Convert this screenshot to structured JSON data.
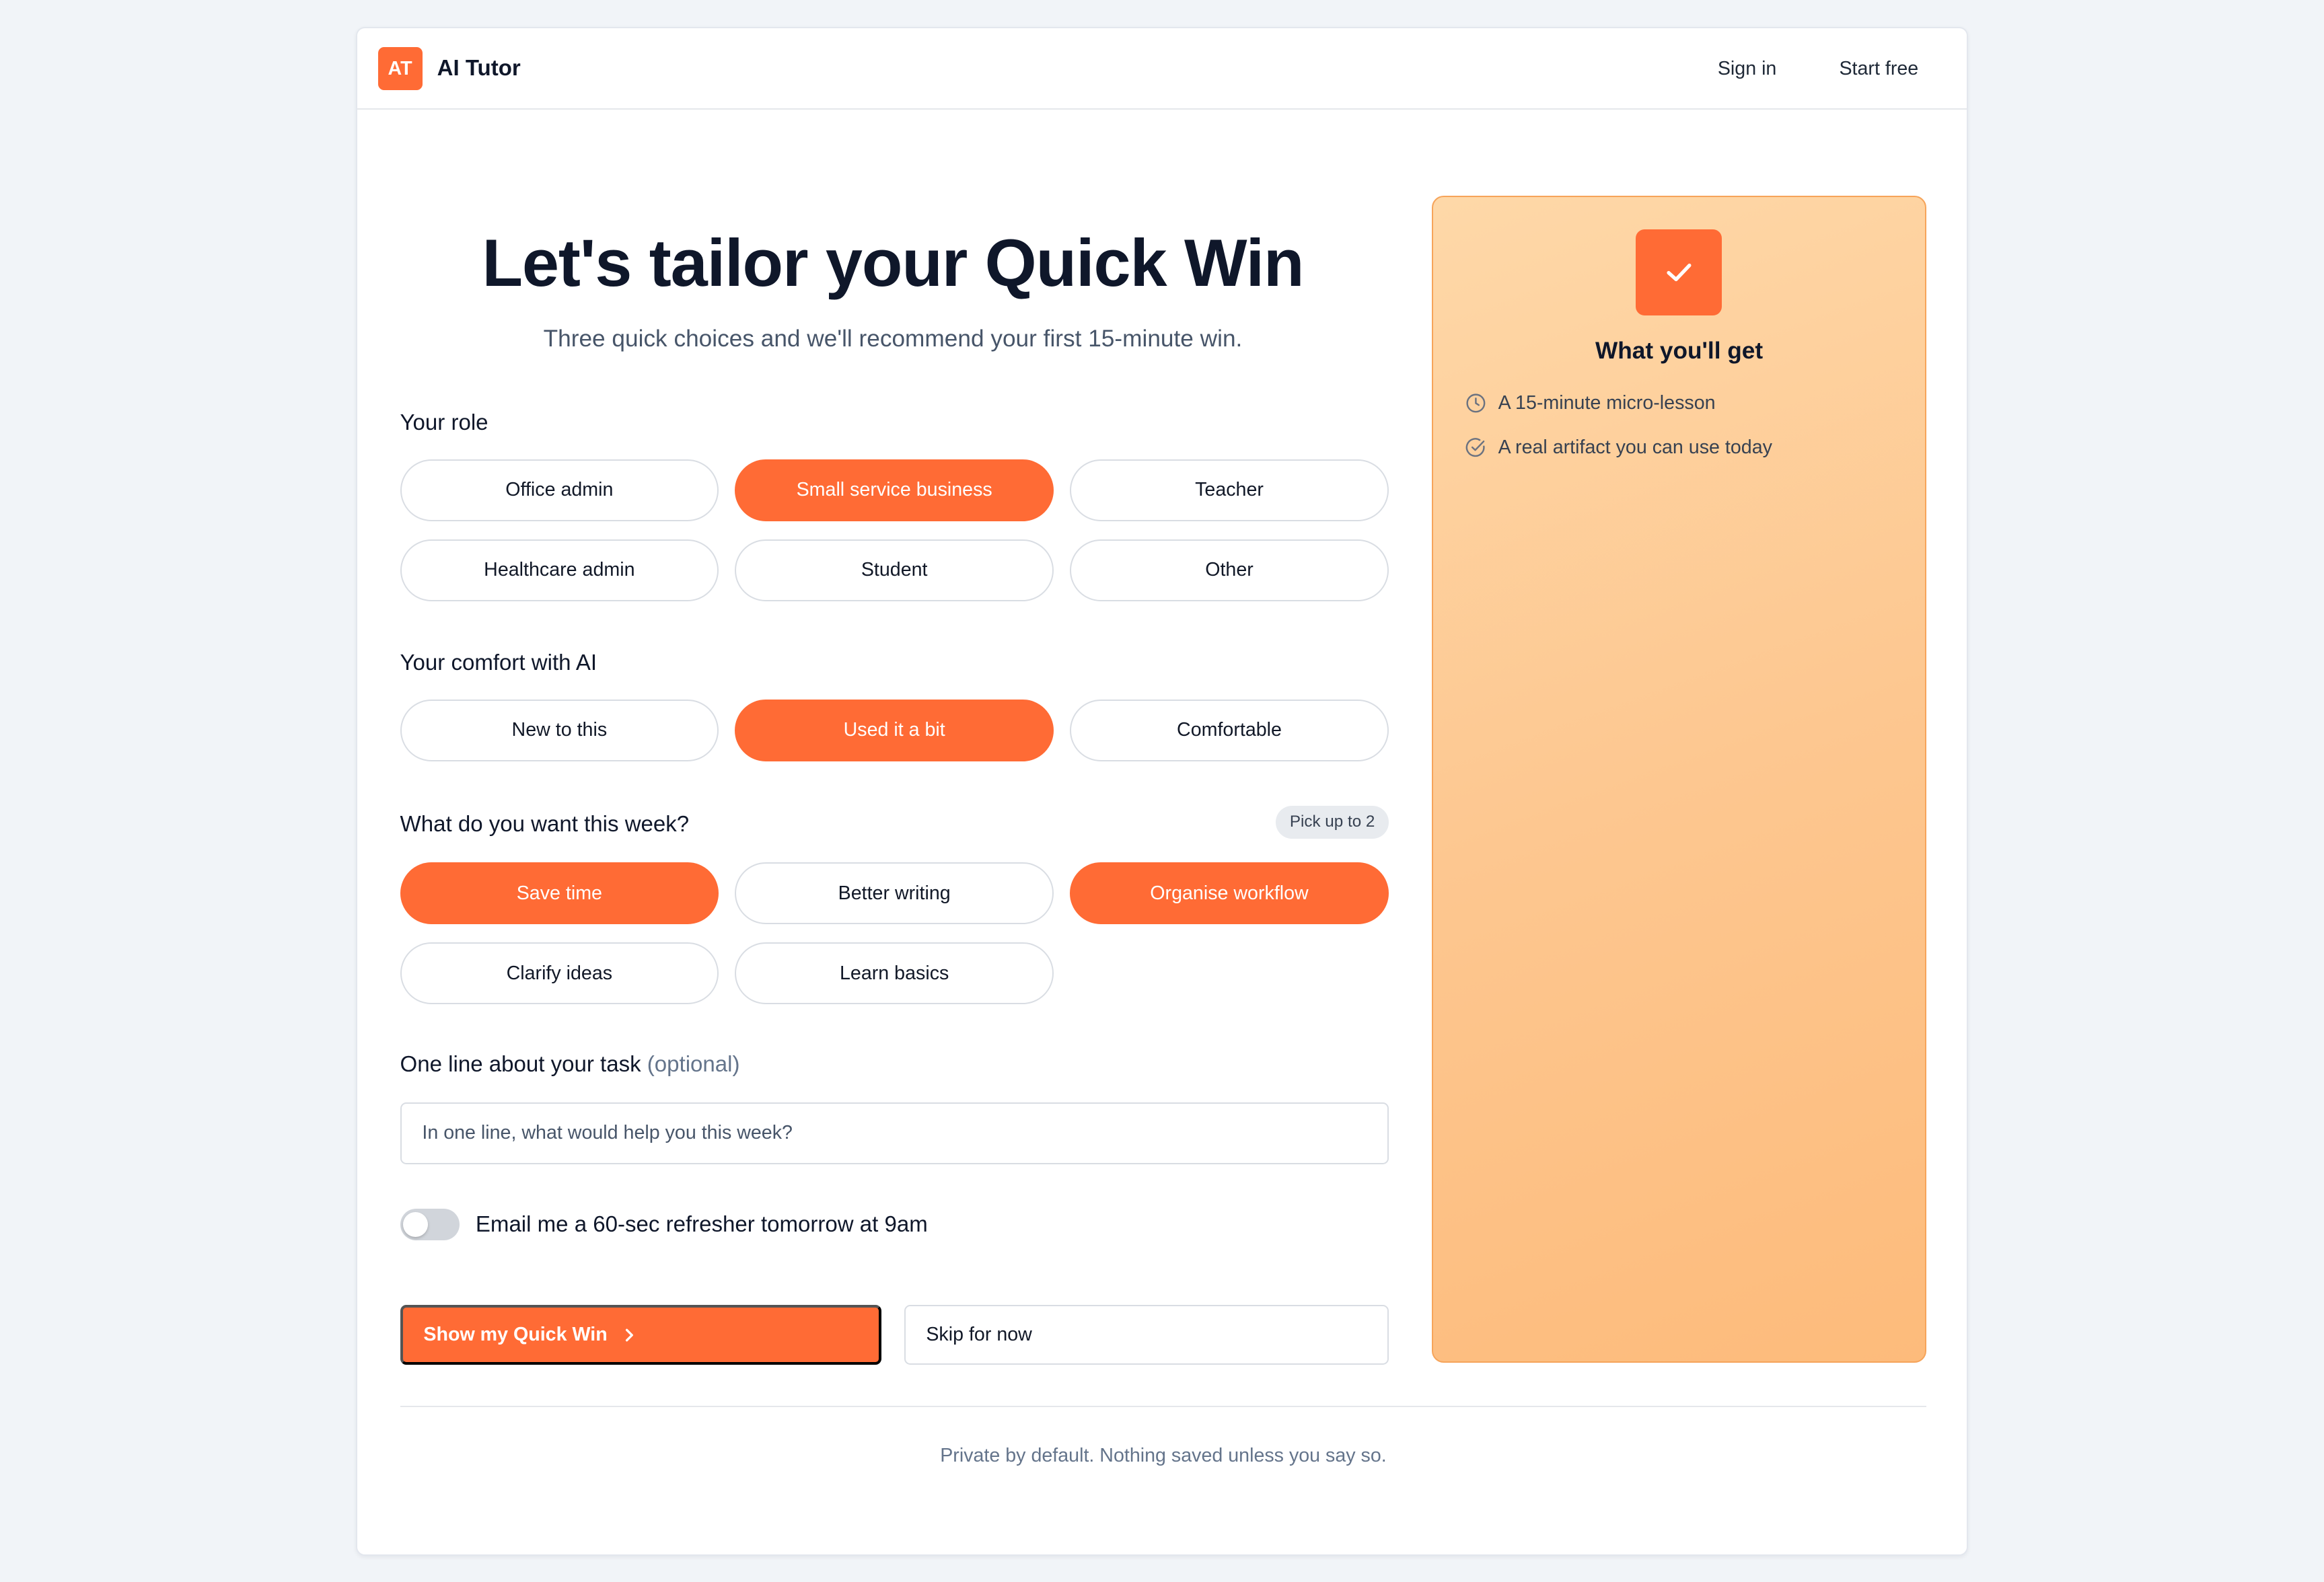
{
  "brand": {
    "logo_text": "AT",
    "name": "AI Tutor"
  },
  "nav": {
    "sign_in": "Sign in",
    "start_free": "Start free"
  },
  "hero": {
    "title": "Let's tailor your Quick Win",
    "subtitle": "Three quick choices and we'll recommend your first 15-minute win."
  },
  "role": {
    "label": "Your role",
    "options": [
      "Office admin",
      "Small service business",
      "Teacher",
      "Healthcare admin",
      "Student",
      "Other"
    ],
    "selected": [
      "Small service business"
    ]
  },
  "comfort": {
    "label": "Your comfort with AI",
    "options": [
      "New to this",
      "Used it a bit",
      "Comfortable"
    ],
    "selected": [
      "Used it a bit"
    ]
  },
  "goals": {
    "label": "What do you want this week?",
    "badge": "Pick up to 2",
    "options": [
      "Save time",
      "Better writing",
      "Organise workflow",
      "Clarify ideas",
      "Learn basics"
    ],
    "selected": [
      "Save time",
      "Organise workflow"
    ]
  },
  "task": {
    "label": "One line about your task",
    "optional": "(optional)",
    "placeholder": "In one line, what would help you this week?",
    "value": ""
  },
  "reminder": {
    "label": "Email me a 60-sec refresher tomorrow at 9am",
    "enabled": false
  },
  "actions": {
    "primary": "Show my Quick Win",
    "secondary": "Skip for now"
  },
  "footer": {
    "note": "Private by default. Nothing saved unless you say so."
  },
  "side_panel": {
    "title": "What you'll get",
    "benefits": [
      {
        "icon": "clock-icon",
        "text": "A 15-minute micro-lesson"
      },
      {
        "icon": "check-circle-icon",
        "text": "A real artifact you can use today"
      }
    ]
  },
  "colors": {
    "accent": "#ff6b35",
    "panel_gradient_start": "#fed8a8",
    "panel_gradient_end": "#fdbb7b",
    "background": "#f1f4f8"
  }
}
